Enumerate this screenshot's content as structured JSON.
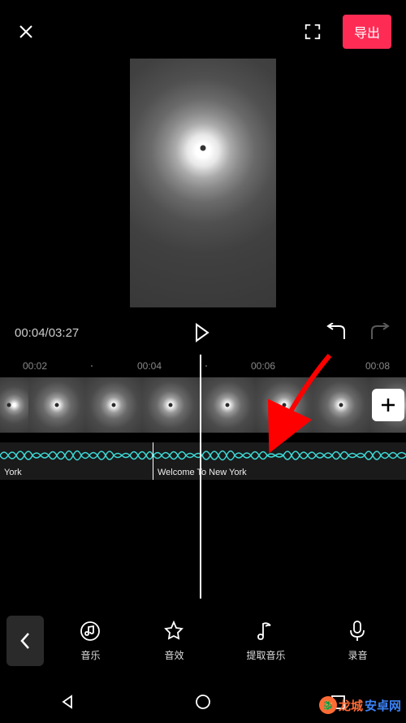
{
  "topbar": {
    "export_label": "导出"
  },
  "time": {
    "current": "00:04",
    "total": "03:27"
  },
  "ruler": {
    "marks": [
      "00:02",
      "00:04",
      "00:06",
      "00:08"
    ]
  },
  "audio": {
    "clip1_label": "York",
    "clip2_label": "Welcome To New York"
  },
  "toolbar": {
    "music_label": "音乐",
    "sfx_label": "音效",
    "extract_label": "提取音乐",
    "record_label": "录音"
  },
  "watermark": {
    "text1": "龙城",
    "text2": "安卓网"
  },
  "colors": {
    "accent": "#fe2c55",
    "waveform": "#3dd9d6"
  }
}
